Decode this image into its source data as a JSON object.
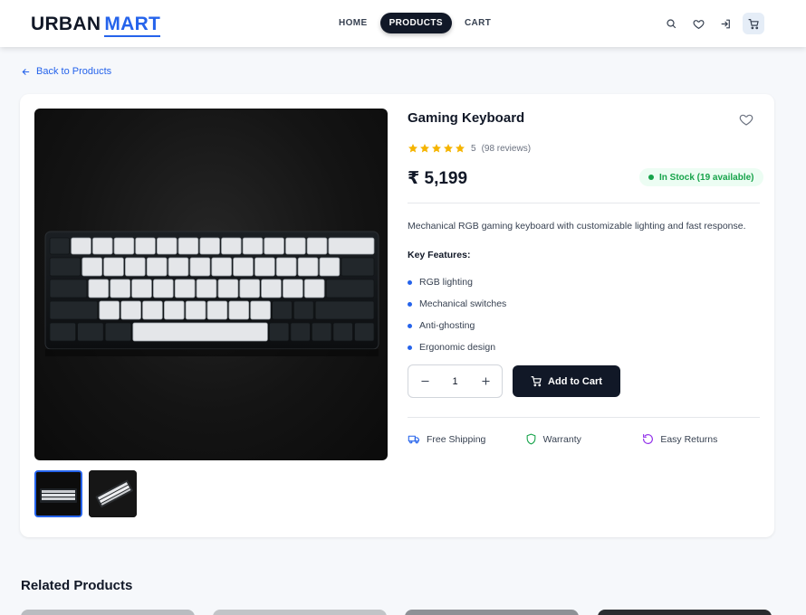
{
  "header": {
    "logo_part1": "URBAN",
    "logo_part2": "MART",
    "nav": [
      "HOME",
      "PRODUCTS",
      "CART"
    ],
    "active_nav": "PRODUCTS",
    "icons": [
      "search-icon",
      "heart-icon",
      "login-icon",
      "cart-icon"
    ]
  },
  "back_link": "Back to Products",
  "product": {
    "title": "Gaming Keyboard",
    "rating": 5,
    "rating_text": "5",
    "reviews": "(98 reviews)",
    "price": "₹ 5,199",
    "stock": "In Stock (19 available)",
    "description": "Mechanical RGB gaming keyboard with customizable lighting and fast response.",
    "features_title": "Key Features:",
    "features": [
      "RGB lighting",
      "Mechanical switches",
      "Anti-ghosting",
      "Ergonomic design"
    ],
    "quantity": "1",
    "add_to_cart": "Add to Cart",
    "perks": [
      "Free Shipping",
      "Warranty",
      "Easy Returns"
    ],
    "thumbnails": 2,
    "selected_thumbnail": 1
  },
  "related_title": "Related Products",
  "colors": {
    "accent": "#2563eb",
    "dark": "#111827",
    "success": "#16a34a",
    "star": "#f5b400",
    "warranty": "#16a34a",
    "returns": "#9333ea"
  }
}
